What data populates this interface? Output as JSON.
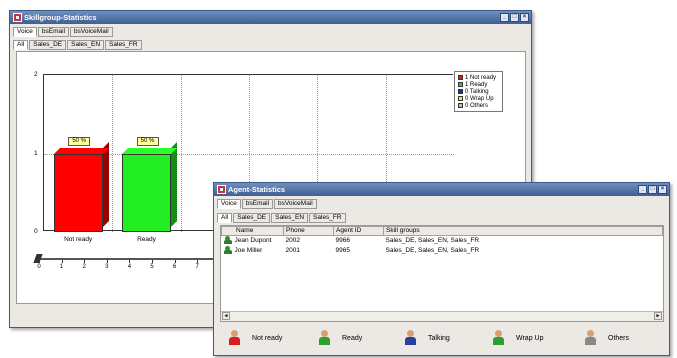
{
  "skillgroup_window": {
    "title": "Skillgroup-Statistics",
    "window_buttons": [
      "_",
      "□",
      "×"
    ],
    "tabs": [
      "Voice",
      "bsEmail",
      "bsVoiceMail"
    ],
    "subtabs": [
      "All",
      "Sales_DE",
      "Sales_EN",
      "Sales_FR"
    ]
  },
  "agent_window": {
    "title": "Agent-Statistics",
    "window_buttons": [
      "_",
      "□",
      "×"
    ],
    "tabs": [
      "Voice",
      "bsEmail",
      "bsVoiceMail"
    ],
    "subtabs": [
      "All",
      "Sales_DE",
      "Sales_EN",
      "Sales_FR"
    ],
    "table": {
      "columns": [
        "Name",
        "Phone",
        "Agent ID",
        "Skill groups"
      ],
      "rows": [
        {
          "name": "Jean Dupont",
          "phone": "2002",
          "agent_id": "9966",
          "skill_groups": "Sales_DE, Sales_EN, Sales_FR"
        },
        {
          "name": "Joe Miller",
          "phone": "2001",
          "agent_id": "9965",
          "skill_groups": "Sales_DE, Sales_EN, Sales_FR"
        }
      ]
    },
    "scroll_left": "◄",
    "scroll_right": "►",
    "status_legend": [
      {
        "label": "Not ready",
        "color": "#d32020"
      },
      {
        "label": "Ready",
        "color": "#2e9e2e"
      },
      {
        "label": "Talking",
        "color": "#2a3f9e"
      },
      {
        "label": "Wrap Up",
        "color": "#2e9e2e"
      },
      {
        "label": "Others",
        "color": "#888888"
      }
    ]
  },
  "chart_data": {
    "type": "bar",
    "categories": [
      "Not ready",
      "Ready"
    ],
    "values": [
      1,
      1
    ],
    "value_labels": [
      "50 %",
      "50 %"
    ],
    "colors": [
      "#ff0000",
      "#22ee22"
    ],
    "ylim": [
      0,
      2
    ],
    "yticks": [
      "0",
      "1",
      "2"
    ],
    "grid": true,
    "legend": {
      "placement": "top-right",
      "entries": [
        {
          "label": "1 Not ready",
          "color": "#ee1111"
        },
        {
          "label": "1 Ready",
          "color": "#11dd11"
        },
        {
          "label": "0 Talking",
          "color": "#1a2fb0"
        },
        {
          "label": "0 Wrap Up",
          "color": "#eeee22"
        },
        {
          "label": "0 Others",
          "color": "#bbbbbb"
        }
      ]
    },
    "slider_ticks": [
      "0",
      "1",
      "2",
      "3",
      "4",
      "5",
      "6",
      "7"
    ]
  }
}
